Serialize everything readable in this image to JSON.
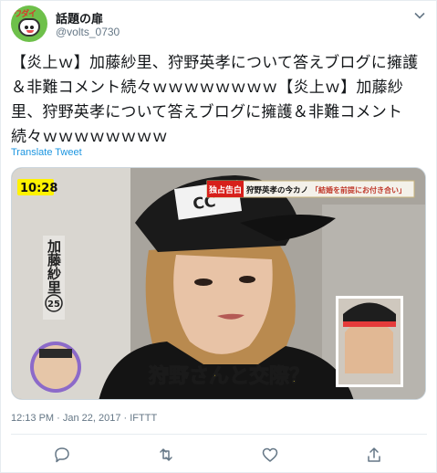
{
  "tweet": {
    "display_name": "話題の扉",
    "handle": "@volts_0730",
    "avatar_text": "ワダイ",
    "text": "【炎上ｗ】加藤紗里、狩野英孝について答えブログに擁護＆非難コメント続々ｗｗｗｗｗｗｗｗ【炎上ｗ】加藤紗里、狩野英孝について答えブログに擁護＆非難コメント続々ｗｗｗｗｗｗｗｗ",
    "translate_label": "Translate Tweet",
    "timestamp": "12:13 PM · Jan 22, 2017 · IFTTT"
  },
  "media": {
    "clock": "10:28",
    "banner": "独占告白 狩野英孝の今カノ「結婚を前提にお付き合い」",
    "banner_red": "独占告白",
    "banner_white": "狩野英孝の今カノ",
    "banner_yellow": "「結婚を前提にお付き合い」",
    "side_name": "加藤紗里",
    "side_age": "25",
    "caption": "狩野さんと交際？",
    "cap_text": "CC"
  },
  "colors": {
    "link": "#1b95e0",
    "muted": "#657786",
    "caption_yellow": "#ffe23a",
    "banner_red": "#d7201b"
  },
  "icons": [
    "chevron-down-icon",
    "reply-icon",
    "retweet-icon",
    "like-icon",
    "share-icon"
  ]
}
